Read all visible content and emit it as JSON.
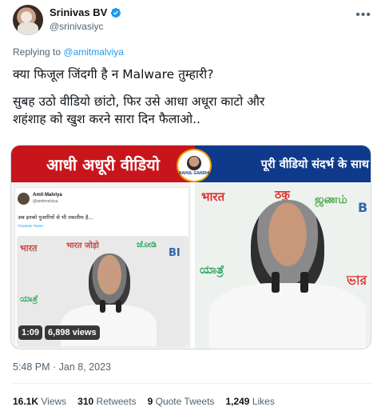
{
  "author": {
    "name": "Srinivas BV",
    "handle": "@srinivasiyc"
  },
  "replying": {
    "prefix": "Replying to",
    "target": "@amitmalviya"
  },
  "tweet": {
    "line1": "क्या फिजूल जिंदगी है न Malware तुम्हारी?",
    "line2": "सुबह उठो वीडियो छांटो, फिर उसे आधा अधूरा काटो और",
    "line3": "शहंशाह को खुश करने सारा दिन फैलाओ.."
  },
  "media": {
    "banner_left": "आधी अधूरी वीडियो",
    "banner_right": "पूरी वीडियो संदर्भ के साथ",
    "logo_text": "RAHUL GANDHI",
    "embed": {
      "name": "Amit Malviya",
      "handle": "@amitmalviya",
      "text": "अब इनको पुजारियों से भी तकलीफ है...",
      "translate": "Translate Tweet"
    },
    "duration": "1:09",
    "views": "6,898 views"
  },
  "timestamp": "5:48 PM · Jan 8, 2023",
  "stats": {
    "views_count": "16.1K",
    "views_label": "Views",
    "retweets_count": "310",
    "retweets_label": "Retweets",
    "quotes_count": "9",
    "quotes_label": "Quote Tweets",
    "likes_count": "1,249",
    "likes_label": "Likes"
  },
  "colors": {
    "verified": "#1d9bf0",
    "banner_left": "#c8151b",
    "banner_right": "#0f3a8c",
    "link": "#1d9bf0"
  }
}
